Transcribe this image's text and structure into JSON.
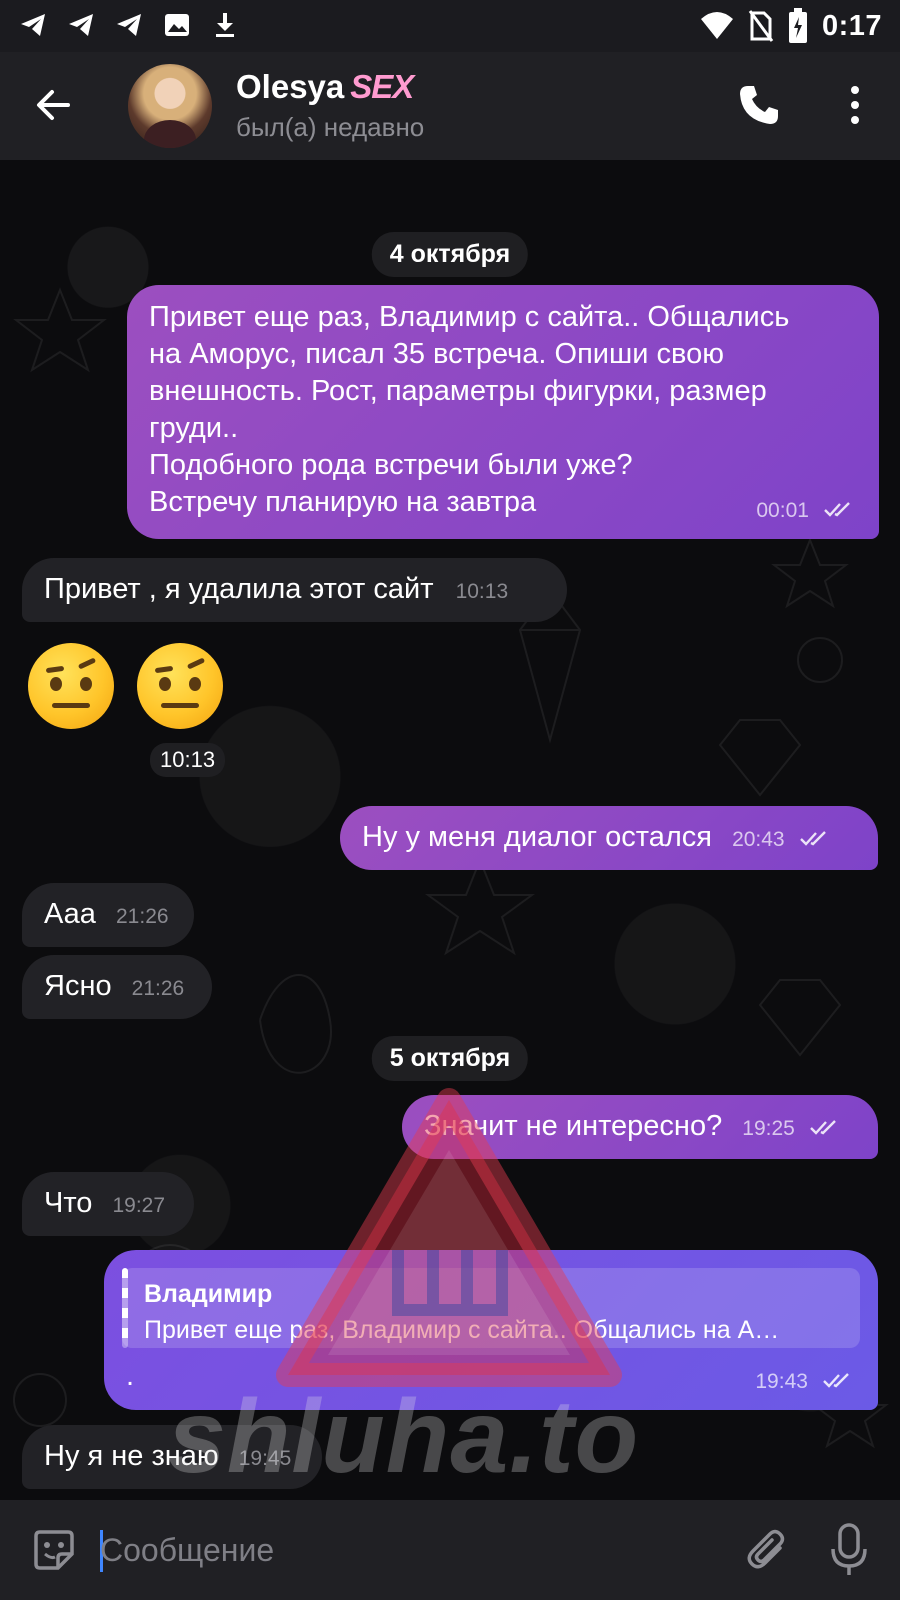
{
  "status_bar": {
    "time": "0:17",
    "left_icons": [
      "telegram-icon",
      "telegram-icon",
      "telegram-icon",
      "image-icon",
      "download-icon"
    ],
    "right_icons": [
      "wifi-icon",
      "no-sim-icon",
      "battery-icon"
    ]
  },
  "header": {
    "name": "Olesya",
    "name_tag": "SEX",
    "status": "был(а) недавно"
  },
  "messages": [
    {
      "type": "date",
      "text": "4 октября"
    },
    {
      "type": "out",
      "text_lines": [
        "Привет еще раз, Владимир с сайта.. Общались",
        "на Аморус, писал 35 встреча. Опиши свою",
        "внешность. Рост, параметры фигурки, размер",
        "груди..",
        "Подобного рода встречи были уже?",
        "Встречу планирую на завтра"
      ],
      "time": "00:01"
    },
    {
      "type": "in",
      "text": "Привет , я удалила этот сайт",
      "time": "10:13"
    },
    {
      "type": "emoji",
      "emoji": "🤨🤨",
      "time": "10:13"
    },
    {
      "type": "out",
      "text": "Ну у меня диалог остался",
      "time": "20:43"
    },
    {
      "type": "in",
      "text": "Ааа",
      "time": "21:26"
    },
    {
      "type": "in",
      "text": "Ясно",
      "time": "21:26"
    },
    {
      "type": "date",
      "text": "5 октября"
    },
    {
      "type": "out",
      "text": "Значит не интересно?",
      "time": "19:25"
    },
    {
      "type": "in",
      "text": "Что",
      "time": "19:27"
    },
    {
      "type": "out_reply",
      "reply_author": "Владимир",
      "reply_text": "Привет еще раз, Владимир с сайта.. Общались на А…",
      "text": ".",
      "time": "19:43"
    },
    {
      "type": "in",
      "text": "Ну я не знаю",
      "time": "19:45"
    }
  ],
  "watermark": {
    "text": "shluha.to"
  },
  "input": {
    "placeholder": "Сообщение"
  },
  "colors": {
    "outgoing_bubble": "#8a48c4",
    "incoming_bubble": "#222226",
    "header_bg": "#202024",
    "chat_bg": "#0c0c0e",
    "accent": "#3f86ff"
  }
}
